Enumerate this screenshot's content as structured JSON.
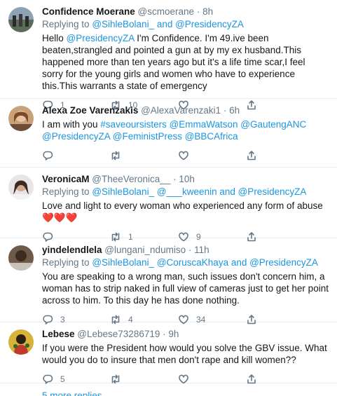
{
  "tweets": [
    {
      "name": "Confidence Moerane",
      "handle": "@scmoerane",
      "time": "8h",
      "reply_prefix": "Replying to",
      "reply_users": "@SihleBolani_ and @PresidencyZA",
      "text_pre": "Hello",
      "mention": "@PresidencyZA",
      "text_post": " I'm Confidence. I'm 49.ive been beaten,strangled and pointed a gun at by my ex husband.This happened more than ten years ago but it's a life time scar,I feel sorry for the young girls and women who have to experience this.This warrants a state of emergency",
      "replies": "1",
      "retweets": "10",
      "likes": ""
    },
    {
      "name": "Alexa Zoe Varenzakis",
      "handle": "@AlexaVarenzaki1",
      "time": "6h",
      "text_pre": "I am with you",
      "mentions": "#saveoursisters @EmmaWatson @GautengANC @PresidencyZA @FeministPress @BBCAfrica",
      "replies": "",
      "retweets": "",
      "likes": ""
    },
    {
      "name": "VeronicaM",
      "handle": "@TheeVeronica__",
      "time": "10h",
      "reply_prefix": "Replying to",
      "reply_users": "@SihleBolani_ @___kweenin and @PresidencyZA",
      "text": "Love and light to every woman who experienced any form of abuse",
      "emoji": "❤️❤️❤️",
      "replies": "",
      "retweets": "1",
      "likes": "9"
    },
    {
      "name": "yindelendlela",
      "handle": "@lungani_ndumiso",
      "time": "11h",
      "reply_prefix": "Replying to",
      "reply_users": "@SihleBolani_ @CoruscaKhaya and @PresidencyZA",
      "text": "You are speaking to a wrong man, such issues don't concern him, a woman has to strip naked in full view of cameras just to get her point across to him. To this day he has done nothing.",
      "replies": "3",
      "retweets": "4",
      "likes": "34"
    },
    {
      "name": "Lebese",
      "handle": "@Lebese73286719",
      "time": "9h",
      "text": "If you were the President how would you solve the GBV issue. What would you do to insure that men don't rape and kill women??",
      "replies": "5",
      "retweets": "",
      "likes": ""
    }
  ],
  "more_replies": "5 more replies",
  "colors": {
    "link": "#1b95e0",
    "muted": "#657786",
    "text": "#14171a",
    "border": "#e6ecf0",
    "heart": "#e0245e"
  }
}
